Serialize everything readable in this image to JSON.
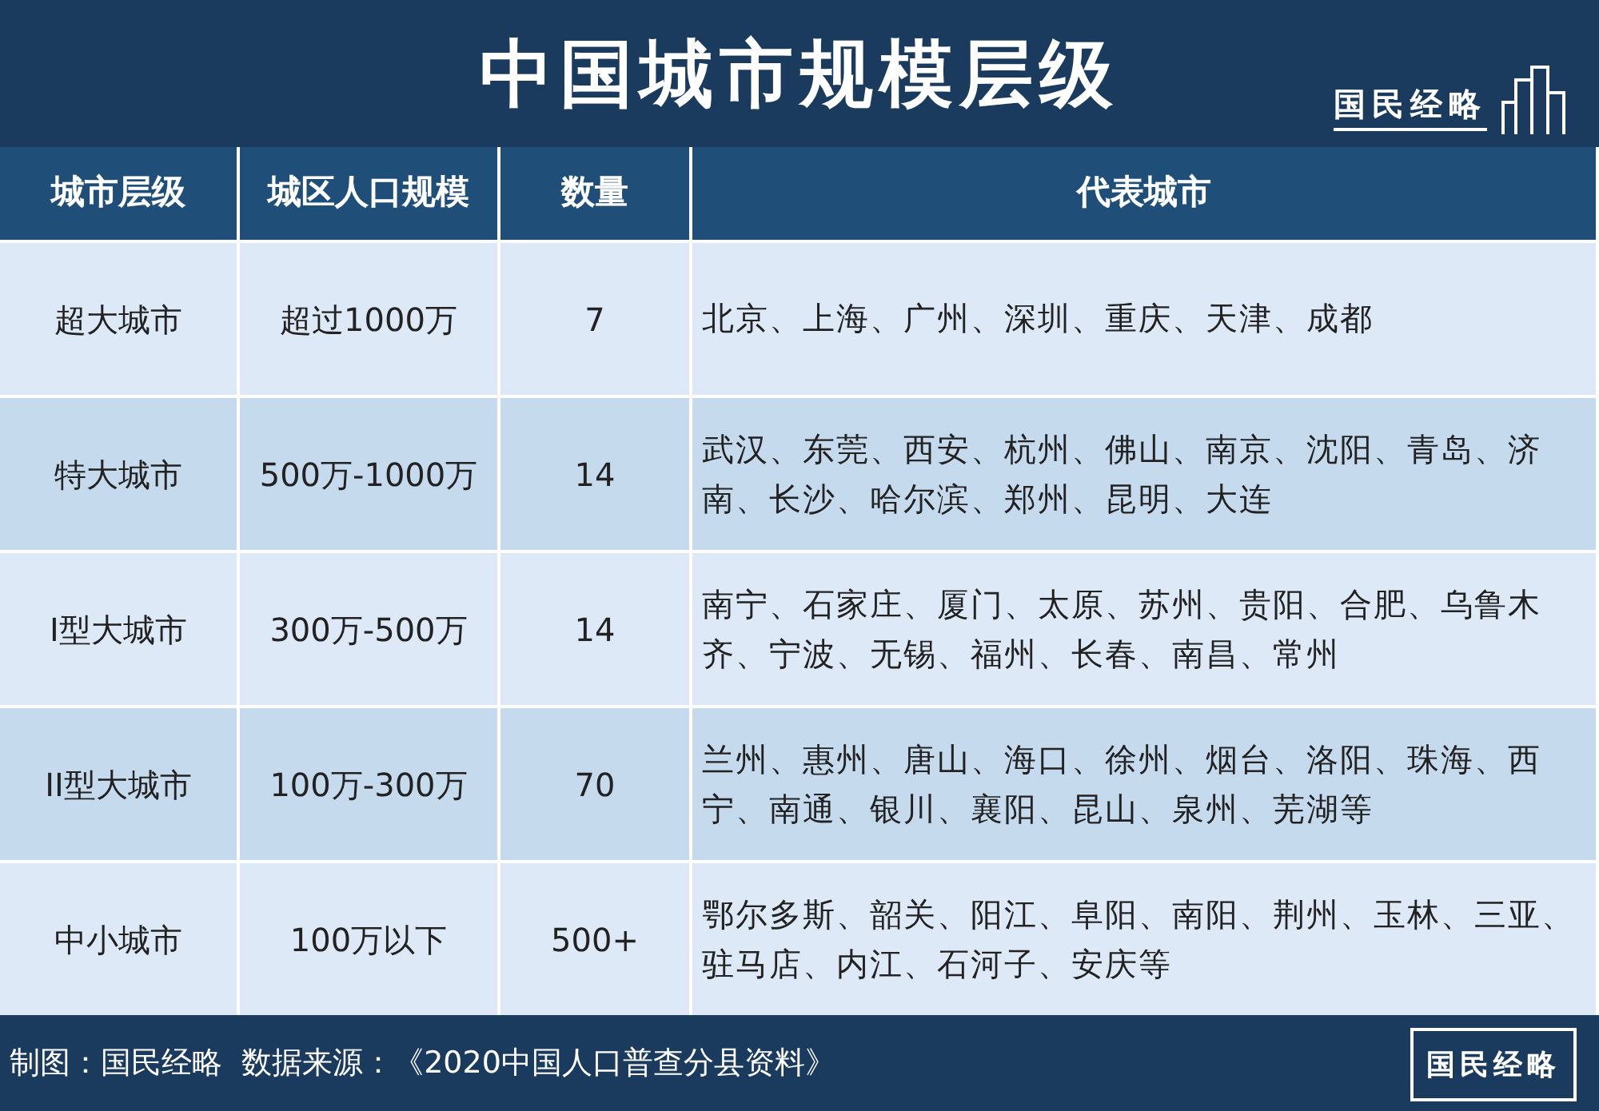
{
  "title": "中国城市规模层级",
  "brand": "国民经略",
  "table": {
    "columns": [
      "城市层级",
      "城区人口规模",
      "数量",
      "代表城市"
    ],
    "rows": [
      {
        "cells": [
          "超大城市",
          "超过1000万",
          "7",
          "北京、上海、广州、深圳、重庆、天津、成都"
        ]
      },
      {
        "cells": [
          "特大城市",
          "500万-1000万",
          "14",
          "武汉、东莞、西安、杭州、佛山、南京、沈阳、青岛、济南、长沙、哈尔滨、郑州、昆明、大连"
        ]
      },
      {
        "cells": [
          "I型大城市",
          "300万-500万",
          "14",
          "南宁、石家庄、厦门、太原、苏州、贵阳、合肥、乌鲁木齐、宁波、无锡、福州、长春、南昌、常州"
        ]
      },
      {
        "cells": [
          "II型大城市",
          "100万-300万",
          "70",
          "兰州、惠州、唐山、海口、徐州、烟台、洛阳、珠海、西宁、南通、银川、襄阳、昆山、泉州、芜湖等"
        ]
      },
      {
        "cells": [
          "中小城市",
          "100万以下",
          "500+",
          "鄂尔多斯、韶关、阳江、阜阳、南阳、荆州、玉林、三亚、驻马店、内江、石河子、安庆等"
        ]
      }
    ]
  },
  "footer": {
    "text": "制图：国民经略  数据来源：《2020中国人口普查分县资料》",
    "badge": "国民经略"
  }
}
